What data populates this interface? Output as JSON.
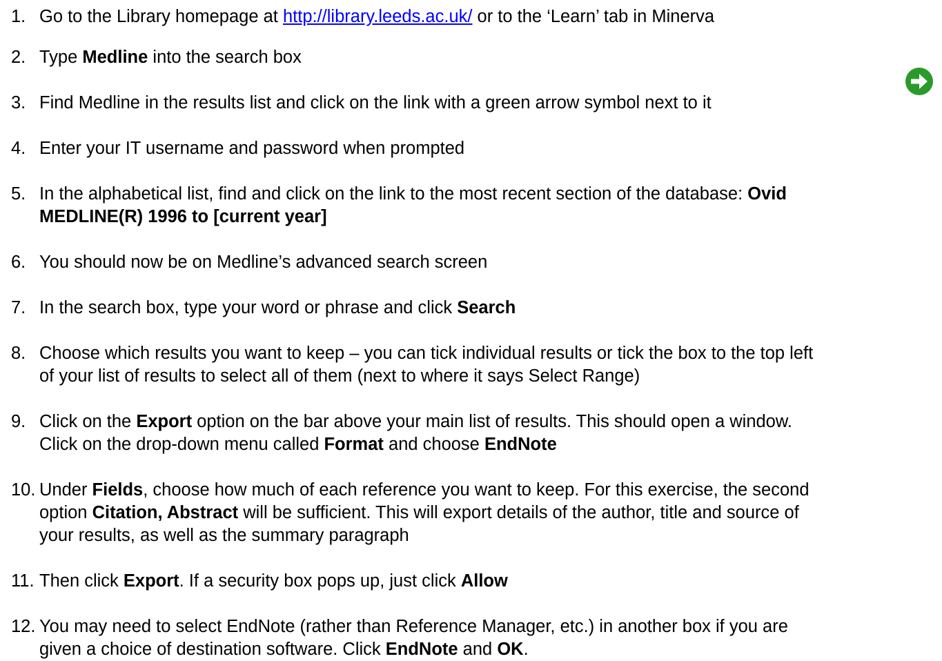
{
  "steps": [
    {
      "number": "1.",
      "lines": [
        [
          {
            "text": "Go to the Library homepage at "
          },
          {
            "text": "http://library.leeds.ac.uk/",
            "link": true
          },
          {
            "text": " or to the ‘Learn’ tab in Minerva"
          }
        ]
      ]
    },
    {
      "number": "2.",
      "lines": [
        [
          {
            "text": "Type "
          },
          {
            "text": "Medline",
            "bold": true
          },
          {
            "text": " into the search box"
          }
        ]
      ]
    },
    {
      "number": "3.",
      "lines": [
        [
          {
            "text": "Find Medline in the results list and click on the link with a green arrow symbol next to it"
          }
        ]
      ]
    },
    {
      "number": "4.",
      "lines": [
        [
          {
            "text": "Enter your IT username and password when prompted"
          }
        ]
      ]
    },
    {
      "number": "5.",
      "lines": [
        [
          {
            "text": "In the alphabetical list, find and click on the link to the most recent section of the database: "
          },
          {
            "text": "Ovid",
            "bold": true
          }
        ],
        [
          {
            "text": "MEDLINE(R) 1996 to [current year]",
            "bold": true
          }
        ]
      ]
    },
    {
      "number": "6.",
      "lines": [
        [
          {
            "text": "You should now be on Medline’s advanced search screen"
          }
        ]
      ]
    },
    {
      "number": "7.",
      "lines": [
        [
          {
            "text": "In the search box, type your word or phrase and click "
          },
          {
            "text": "Search",
            "bold": true
          }
        ]
      ]
    },
    {
      "number": "8.",
      "lines": [
        [
          {
            "text": "Choose which results you want to keep – you can tick individual results or tick the box to the top left"
          }
        ],
        [
          {
            "text": "of your list of results to select all of them (next to where it says Select Range)"
          }
        ]
      ]
    },
    {
      "number": "9.",
      "lines": [
        [
          {
            "text": "Click on the "
          },
          {
            "text": "Export",
            "bold": true
          },
          {
            "text": " option on the bar above your main list of results. This should open a window."
          }
        ],
        [
          {
            "text": "Click on the drop-down menu called "
          },
          {
            "text": "Format",
            "bold": true
          },
          {
            "text": " and choose "
          },
          {
            "text": "EndNote",
            "bold": true
          }
        ]
      ]
    },
    {
      "number": "10.",
      "lines": [
        [
          {
            "text": "Under "
          },
          {
            "text": "Fields",
            "bold": true
          },
          {
            "text": ", choose how much of each reference you want to keep. For this exercise, the second"
          }
        ],
        [
          {
            "text": "option "
          },
          {
            "text": "Citation, Abstract",
            "bold": true
          },
          {
            "text": " will be sufficient. This will export details of the author, title and source of"
          }
        ],
        [
          {
            "text": "your results, as well as the summary paragraph"
          }
        ]
      ]
    },
    {
      "number": "11.",
      "lines": [
        [
          {
            "text": "Then click "
          },
          {
            "text": "Export",
            "bold": true
          },
          {
            "text": ". If a security box pops up, just click "
          },
          {
            "text": "Allow",
            "bold": true
          }
        ]
      ]
    },
    {
      "number": "12.",
      "lines": [
        [
          {
            "text": "You may need to select EndNote (rather than Reference Manager, etc.) in another box if you are"
          }
        ],
        [
          {
            "text": "given a choice of destination software. Click "
          },
          {
            "text": "EndNote",
            "bold": true
          },
          {
            "text": " and "
          },
          {
            "text": "OK",
            "bold": true
          },
          {
            "text": "."
          }
        ]
      ]
    }
  ],
  "icons": {
    "green_arrow": {
      "name": "green-arrow-icon",
      "color": "#2a9a2a",
      "arrow_color": "#ffffff"
    }
  }
}
